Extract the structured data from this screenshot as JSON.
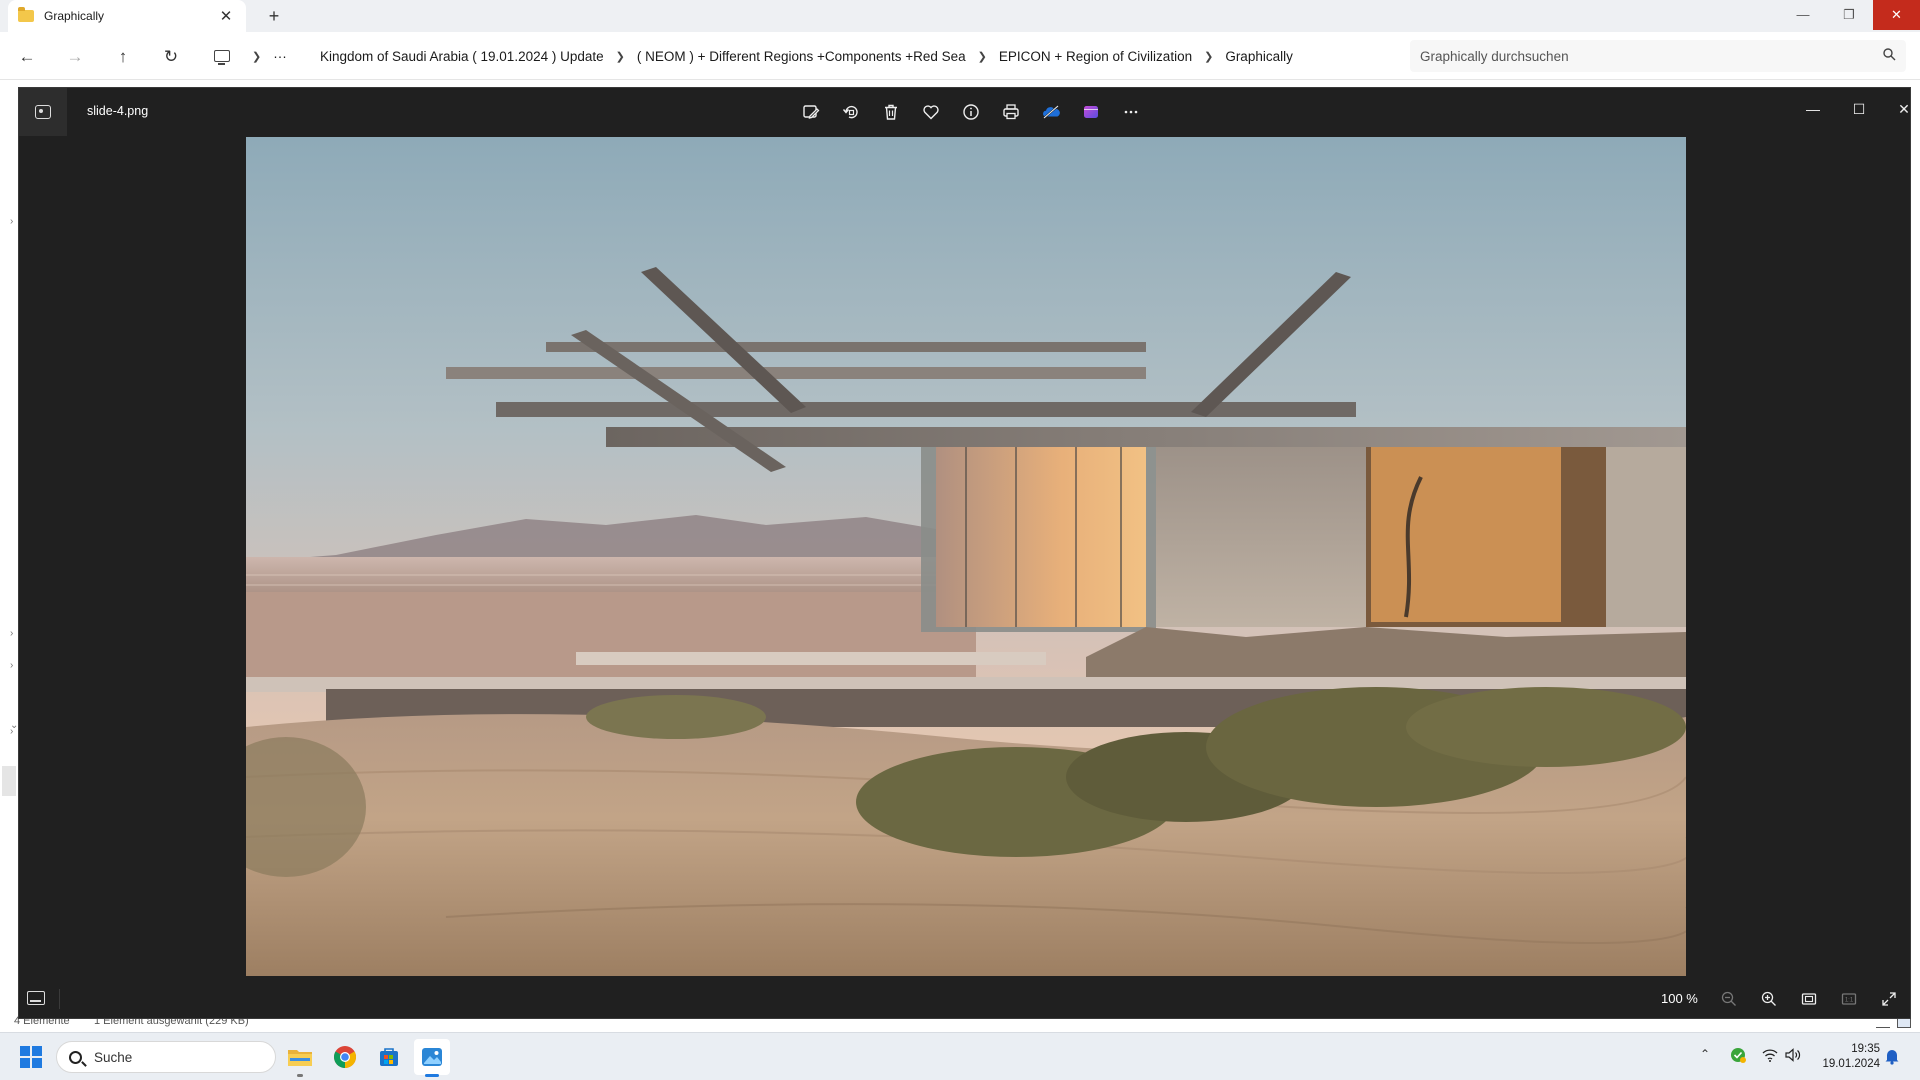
{
  "explorer": {
    "tab_title": "Graphically",
    "tab_close": "✕",
    "new_tab": "+",
    "window_controls": {
      "minimize": "—",
      "restore": "❐",
      "close": "✕"
    },
    "breadcrumb": {
      "more": "···",
      "items": [
        "Kingdom of Saudi Arabia ( 19.01.2024 ) Update",
        "( NEOM ) + Different Regions +Components +Red Sea",
        "EPICON + Region of Civilization",
        "Graphically"
      ]
    },
    "search_placeholder": "Graphically durchsuchen",
    "status": {
      "item_count": "4 Elemente",
      "selection": "1 Element ausgewählt (229 KB)"
    }
  },
  "viewer": {
    "filename": "slide-4.png",
    "toolbar": [
      {
        "name": "edit-image-icon",
        "label": "Bild bearbeiten"
      },
      {
        "name": "rotate-icon",
        "label": "Drehen"
      },
      {
        "name": "delete-icon",
        "label": "Löschen"
      },
      {
        "name": "favorite-icon",
        "label": "Favorit"
      },
      {
        "name": "info-icon",
        "label": "Dateiinformationen"
      },
      {
        "name": "print-icon",
        "label": "Drucken"
      },
      {
        "name": "onedrive-icon",
        "label": "OneDrive"
      },
      {
        "name": "clipchamp-icon",
        "label": "Clipchamp"
      },
      {
        "name": "more-icon",
        "label": "Weitere Optionen"
      }
    ],
    "zoom": "100 %",
    "image_alt": "slide-4.png"
  },
  "taskbar": {
    "search_label": "Suche",
    "time": "19:35",
    "date": "19.01.2024"
  },
  "colors": {
    "accent": "#1f7ae0",
    "close_red": "#c42b1c",
    "viewer_bg": "#202020"
  }
}
